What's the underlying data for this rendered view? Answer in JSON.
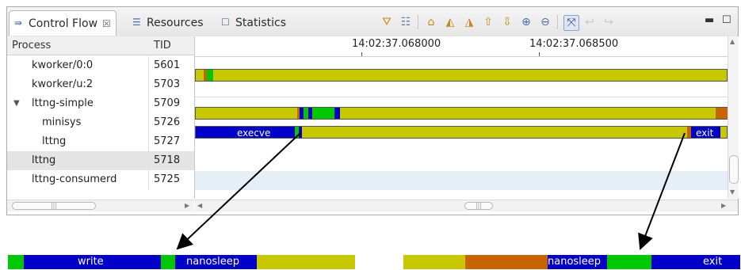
{
  "tabs": [
    {
      "label": "Control Flow",
      "close": "☒",
      "icon": "control-flow-icon"
    },
    {
      "label": "Resources",
      "icon": "resources-icon"
    },
    {
      "label": "Statistics",
      "icon": "statistics-icon"
    }
  ],
  "toolbar_icons": [
    "filter-icon",
    "legend-icon",
    "home-icon",
    "select-previous-icon",
    "select-next-icon",
    "previous-event-icon",
    "next-event-icon",
    "zoom-in-icon",
    "zoom-out-icon",
    "hide-arrows-icon",
    "follow-arrow-back-icon",
    "follow-arrow-forward-icon",
    "minimize-icon",
    "maximize-icon"
  ],
  "columns": {
    "process": "Process",
    "tid": "TID"
  },
  "rows": [
    {
      "process": "kworker/0:0",
      "tid": "5601"
    },
    {
      "process": "kworker/u:2",
      "tid": "5703"
    },
    {
      "process": "lttng-simple",
      "tid": "5709",
      "expanded": true
    },
    {
      "process": "minisys",
      "tid": "5726"
    },
    {
      "process": "lttng",
      "tid": "5727"
    },
    {
      "process": "lttng",
      "tid": "5718",
      "selected": true
    },
    {
      "process": "lttng-consumerd",
      "tid": "5725"
    }
  ],
  "time_ticks": [
    "14:02:37.068000",
    "14:02:37.068500"
  ],
  "state_labels": {
    "execve": "execve",
    "exit": "exit"
  },
  "zoom_left": {
    "write": "write",
    "nanosleep": "nanosleep"
  },
  "zoom_right": {
    "nanosleep": "nanosleep",
    "exit": "exit"
  },
  "colors": {
    "running": "#c8c800",
    "syscall": "#0000c8",
    "wait": "#00c800",
    "blocked": "#c86400",
    "selected_row": "#e6eef8"
  }
}
